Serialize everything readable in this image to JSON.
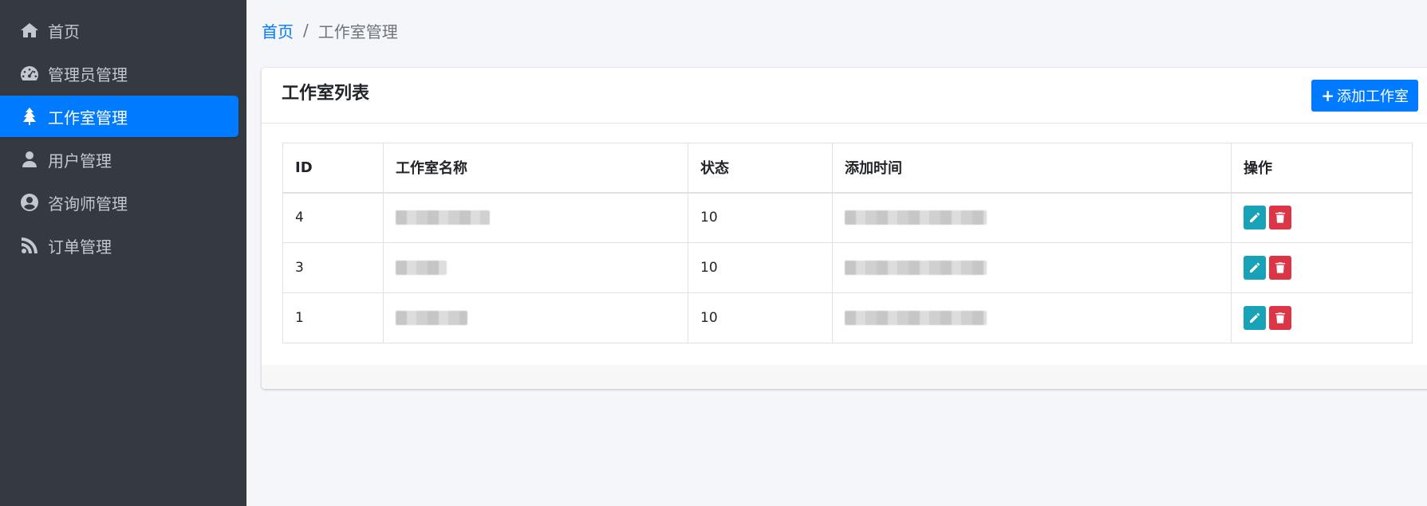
{
  "sidebar": {
    "items": [
      {
        "label": "首页",
        "icon": "home-icon"
      },
      {
        "label": "管理员管理",
        "icon": "dashboard-icon"
      },
      {
        "label": "工作室管理",
        "icon": "tree-icon",
        "active": true
      },
      {
        "label": "用户管理",
        "icon": "user-icon"
      },
      {
        "label": "咨询师管理",
        "icon": "user-circle-icon"
      },
      {
        "label": "订单管理",
        "icon": "rss-icon"
      }
    ]
  },
  "breadcrumb": {
    "home": "首页",
    "separator": "/",
    "current": "工作室管理"
  },
  "card": {
    "title": "工作室列表",
    "add_button": "添加工作室"
  },
  "table": {
    "headers": [
      "ID",
      "工作室名称",
      "状态",
      "添加时间",
      "操作"
    ],
    "rows": [
      {
        "id": "4",
        "name": "",
        "status": "10",
        "time": ""
      },
      {
        "id": "3",
        "name": "",
        "status": "10",
        "time": ""
      },
      {
        "id": "1",
        "name": "",
        "status": "10",
        "time": ""
      }
    ]
  },
  "colors": {
    "sidebar_bg": "#343a40",
    "accent": "#007bff",
    "edit": "#17a2b8",
    "delete": "#dc3545"
  }
}
